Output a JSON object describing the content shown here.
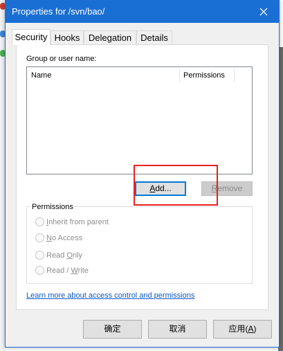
{
  "dialog": {
    "title": "Properties for /svn/bao/"
  },
  "tabs": [
    {
      "label": "Security"
    },
    {
      "label": "Hooks"
    },
    {
      "label": "Delegation"
    },
    {
      "label": "Details"
    }
  ],
  "security": {
    "group_label": "Group or user name:",
    "columns": [
      "Name",
      "Permissions"
    ],
    "add_button": {
      "before": "",
      "mnemonic": "A",
      "after": "dd..."
    },
    "remove_button": {
      "before": "",
      "mnemonic": "R",
      "after": "emove"
    },
    "permissions": {
      "title": "Permissions",
      "options": [
        {
          "before": "",
          "mnemonic": "I",
          "after": "nherit from parent"
        },
        {
          "before": "",
          "mnemonic": "N",
          "after": "o Access"
        },
        {
          "before": "Read ",
          "mnemonic": "O",
          "after": "nly"
        },
        {
          "before": "Read / ",
          "mnemonic": "W",
          "after": "rite"
        }
      ]
    },
    "learn_more_link": "Learn more about access control and permissions"
  },
  "footer": {
    "ok": "确定",
    "cancel": "取消",
    "apply": {
      "before": "应用(",
      "mnemonic": "A",
      "after": ")"
    }
  },
  "colors": {
    "titlebar": "#1a6fd4",
    "highlight": "#e8201e",
    "link": "#0a58ca",
    "focus_border": "#0078d7"
  },
  "icons": {
    "close": "close-icon"
  }
}
